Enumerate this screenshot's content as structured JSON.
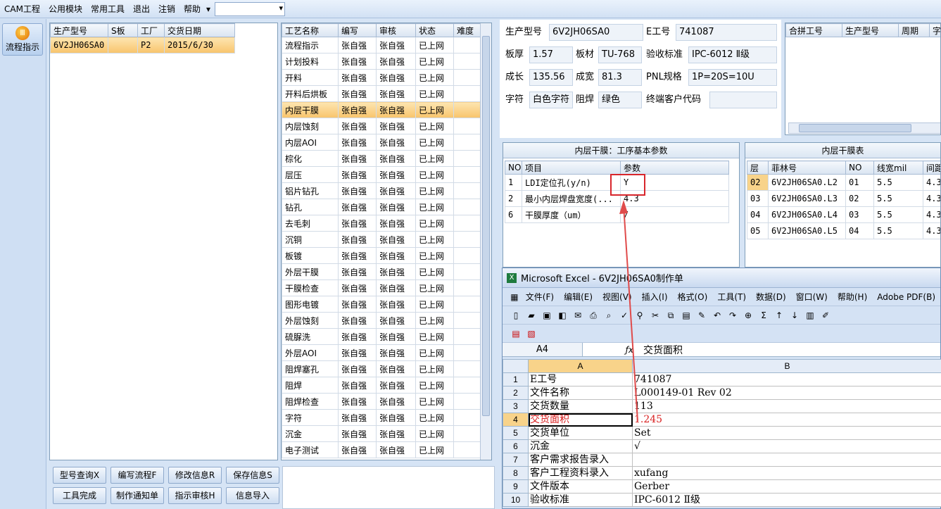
{
  "menu": [
    "CAM工程",
    "公用模块",
    "常用工具",
    "退出",
    "注销",
    "帮助"
  ],
  "side": {
    "flow_label": "流程指示"
  },
  "order_grid": {
    "cols": [
      "生产型号",
      "S板",
      "工厂",
      "交货日期"
    ],
    "rows": [
      [
        "6V2JH06SA0",
        "",
        "P2",
        "2015/6/30"
      ]
    ]
  },
  "process_grid": {
    "cols": [
      "工艺名称",
      "编写",
      "审核",
      "状态",
      "难度"
    ],
    "rows": [
      [
        "流程指示",
        "张自强",
        "张自强",
        "已上网",
        ""
      ],
      [
        "计划投料",
        "张自强",
        "张自强",
        "已上网",
        ""
      ],
      [
        "开料",
        "张自强",
        "张自强",
        "已上网",
        ""
      ],
      [
        "开料后烘板",
        "张自强",
        "张自强",
        "已上网",
        ""
      ],
      [
        "内层干膜",
        "张自强",
        "张自强",
        "已上网",
        ""
      ],
      [
        "内层蚀刻",
        "张自强",
        "张自强",
        "已上网",
        ""
      ],
      [
        "内层AOI",
        "张自强",
        "张自强",
        "已上网",
        ""
      ],
      [
        "棕化",
        "张自强",
        "张自强",
        "已上网",
        ""
      ],
      [
        "层压",
        "张自强",
        "张自强",
        "已上网",
        ""
      ],
      [
        "铝片钻孔",
        "张自强",
        "张自强",
        "已上网",
        ""
      ],
      [
        "钻孔",
        "张自强",
        "张自强",
        "已上网",
        ""
      ],
      [
        "去毛刺",
        "张自强",
        "张自强",
        "已上网",
        ""
      ],
      [
        "沉铜",
        "张自强",
        "张自强",
        "已上网",
        ""
      ],
      [
        "板镀",
        "张自强",
        "张自强",
        "已上网",
        ""
      ],
      [
        "外层干膜",
        "张自强",
        "张自强",
        "已上网",
        ""
      ],
      [
        "干膜检查",
        "张自强",
        "张自强",
        "已上网",
        ""
      ],
      [
        "图形电镀",
        "张自强",
        "张自强",
        "已上网",
        ""
      ],
      [
        "外层蚀刻",
        "张自强",
        "张自强",
        "已上网",
        ""
      ],
      [
        "硫脲洗",
        "张自强",
        "张自强",
        "已上网",
        ""
      ],
      [
        "外层AOI",
        "张自强",
        "张自强",
        "已上网",
        ""
      ],
      [
        "阻焊塞孔",
        "张自强",
        "张自强",
        "已上网",
        ""
      ],
      [
        "阻焊",
        "张自强",
        "张自强",
        "已上网",
        ""
      ],
      [
        "阻焊检查",
        "张自强",
        "张自强",
        "已上网",
        ""
      ],
      [
        "字符",
        "张自强",
        "张自强",
        "已上网",
        ""
      ],
      [
        "沉金",
        "张自强",
        "张自强",
        "已上网",
        ""
      ],
      [
        "电子测试",
        "张自强",
        "张自强",
        "已上网",
        ""
      ]
    ],
    "selected": 4
  },
  "buttons": [
    "型号查询X",
    "编写流程F",
    "修改信息R",
    "保存信息S",
    "工具完成",
    "制作通知单",
    "指示审核H",
    "信息导入"
  ],
  "info": {
    "model_label": "生产型号",
    "model": "6V2JH06SA0",
    "eno_label": "E工号",
    "eno": "741087",
    "thick_label": "板厚",
    "thick": "1.57",
    "mat_label": "板材",
    "mat": "TU-768",
    "std_label": "验收标准",
    "std": "IPC-6012 Ⅱ级",
    "len_label": "成长",
    "len": "135.56",
    "wid_label": "成宽",
    "wid": "81.3",
    "pnl_label": "PNL规格",
    "pnl": "1P=20S=10U",
    "char_label": "字符",
    "char": "白色字符",
    "mask_label": "阻焊",
    "mask": "绿色",
    "cust_label": "终端客户代码",
    "cust": ""
  },
  "merge_grid": {
    "cols": [
      "合拼工号",
      "生产型号",
      "周期",
      "字"
    ]
  },
  "param_grid": {
    "title": "内层干膜：工序基本参数",
    "cols": [
      "NO",
      "项目",
      "参数"
    ],
    "rows": [
      [
        "1",
        "LDI定位孔(y/n)",
        "Y"
      ],
      [
        "2",
        "最小内层焊盘宽度(...",
        "4.3"
      ],
      [
        "6",
        "干膜厚度（um）",
        "/"
      ]
    ]
  },
  "film_grid": {
    "title": "内层干膜表",
    "cols": [
      "层",
      "菲林号",
      "NO",
      "线宽mil",
      "间距"
    ],
    "rows": [
      [
        "02",
        "6V2JH06SA0.L2",
        "01",
        "5.5",
        "4.3"
      ],
      [
        "03",
        "6V2JH06SA0.L3",
        "02",
        "5.5",
        "4.3"
      ],
      [
        "04",
        "6V2JH06SA0.L4",
        "03",
        "5.5",
        "4.3"
      ],
      [
        "05",
        "6V2JH06SA0.L5",
        "04",
        "5.5",
        "4.3"
      ]
    ]
  },
  "excel": {
    "title": "Microsoft Excel - 6V2JH06SA0制作单",
    "menu": [
      "文件(F)",
      "编辑(E)",
      "视图(V)",
      "插入(I)",
      "格式(O)",
      "工具(T)",
      "数据(D)",
      "窗口(W)",
      "帮助(H)",
      "Adobe PDF(B)"
    ],
    "cell_ref": "A4",
    "formula": "交货面积",
    "col_a": "A",
    "col_b": "B",
    "rows": [
      [
        "1",
        "E工号",
        "741087"
      ],
      [
        "2",
        "文件名称",
        "L000149-01 Rev 02"
      ],
      [
        "3",
        "交货数量",
        "113"
      ],
      [
        "4",
        "交货面积",
        "1.245"
      ],
      [
        "5",
        "交货单位",
        "Set"
      ],
      [
        "6",
        "沉金",
        "√"
      ],
      [
        "7",
        "客户需求报告录入",
        ""
      ],
      [
        "8",
        "客户工程资料录入",
        "xufang"
      ],
      [
        "9",
        "文件版本",
        "Gerber"
      ],
      [
        "10",
        "验收标准",
        "IPC-6012 Ⅱ级"
      ]
    ]
  }
}
